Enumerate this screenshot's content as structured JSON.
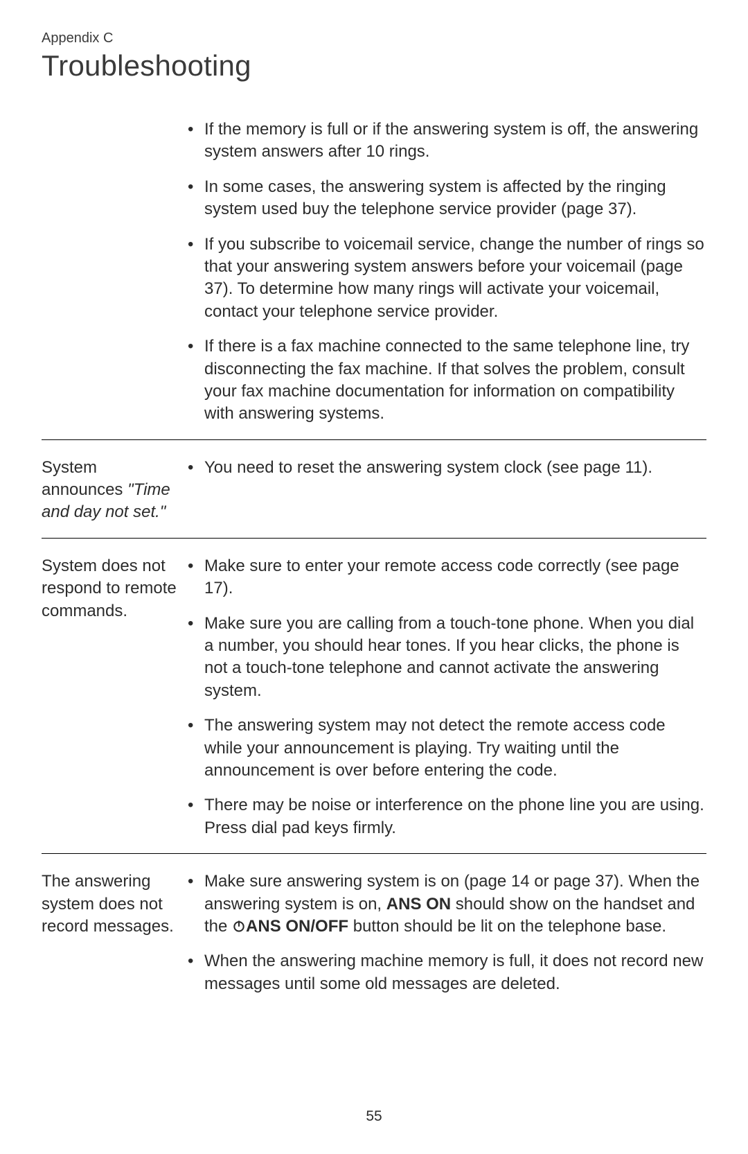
{
  "header": {
    "appendix": "Appendix C",
    "title": "Troubleshooting"
  },
  "rows": [
    {
      "problem_parts": [],
      "solutions": [
        {
          "parts": [
            {
              "t": "If the memory is full or if the answering system is off, the answering system answers after 10 rings."
            }
          ]
        },
        {
          "parts": [
            {
              "t": "In some cases, the answering system is affected by the ringing system used buy the telephone service provider (page 37)."
            }
          ]
        },
        {
          "parts": [
            {
              "t": "If you subscribe to voicemail service, change the number of rings so that your answering system answers before your voicemail (page 37). To determine how many rings will activate your voicemail, contact your telephone service provider."
            }
          ]
        },
        {
          "parts": [
            {
              "t": "If there is a fax machine connected to the same telephone line, try disconnecting the fax machine. If that solves the problem, consult your fax machine documentation for information on compatibility with answering systems."
            }
          ]
        }
      ]
    },
    {
      "problem_parts": [
        {
          "t": "System announces "
        },
        {
          "t": "\"Time and day not set.\"",
          "style": "italic"
        }
      ],
      "solutions": [
        {
          "parts": [
            {
              "t": "You need to reset the answering system clock (see page 11)."
            }
          ]
        }
      ]
    },
    {
      "problem_parts": [
        {
          "t": "System does not respond to remote commands."
        }
      ],
      "solutions": [
        {
          "parts": [
            {
              "t": "Make sure to enter your remote access code correctly (see page 17)."
            }
          ]
        },
        {
          "parts": [
            {
              "t": "Make sure you are calling from a touch-tone phone. When you dial a number, you should hear tones. If you hear clicks, the phone is not a touch-tone telephone and cannot activate the answering system."
            }
          ]
        },
        {
          "parts": [
            {
              "t": "The answering system may not detect the remote access code while your announcement is playing. Try waiting until the announcement is over before entering the code."
            }
          ]
        },
        {
          "parts": [
            {
              "t": "There may be noise or interference on the phone line you are using. Press dial pad keys firmly."
            }
          ]
        }
      ]
    },
    {
      "problem_parts": [
        {
          "t": "The answering system does not record messages."
        }
      ],
      "solutions": [
        {
          "parts": [
            {
              "t": "Make sure answering system is on (page 14 or page 37). When the answering system is on, "
            },
            {
              "t": "ANS ON",
              "style": "bold"
            },
            {
              "t": " should show on the handset and the "
            },
            {
              "icon": "power-icon"
            },
            {
              "t": "ANS ON/OFF",
              "style": "bold"
            },
            {
              "t": " button should be lit on the telephone base."
            }
          ]
        },
        {
          "parts": [
            {
              "t": "When the answering machine memory is full, it does not record new messages until some old messages are deleted."
            }
          ]
        }
      ]
    }
  ],
  "page_number": "55"
}
